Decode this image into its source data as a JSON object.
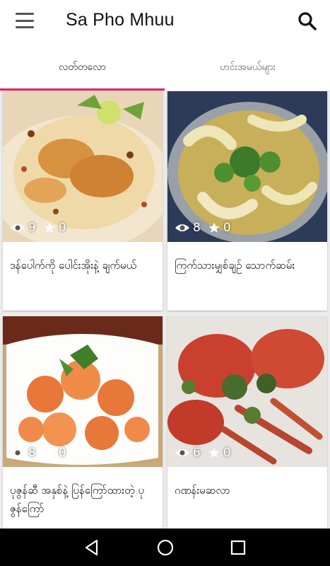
{
  "app": {
    "title": "Sa Pho Mhuu"
  },
  "tabs": [
    {
      "label": "လတ်တလော",
      "active": true
    },
    {
      "label": "ဟင်းအမယ်များ",
      "active": false
    }
  ],
  "colors": {
    "tab_indicator": "#e91e63",
    "appbar": "#ffffff",
    "background": "#ececec"
  },
  "cards": [
    {
      "title": "ဒန်ပေါက်ကို ပေါင်းအိုးနဲ့ ချက်မယ်",
      "views": "9",
      "stars": "0",
      "image": "chicken-biryani-photo"
    },
    {
      "title": "ကြက်သားမျှစ်ချဉ် သောက်ဆမ်း",
      "views": "8",
      "stars": "0",
      "image": "chicken-feet-curry-photo"
    },
    {
      "title": "ပုဇွန်ဆီ အနှစ်နဲ့ ပြန်ကြော်ထားတဲ့ ပုဇွန်ကြော်",
      "views": "8",
      "stars": "0",
      "image": "fried-prawns-photo"
    },
    {
      "title": "ဂဏန်းမဆလာ",
      "views": "6",
      "stars": "0",
      "image": "crab-masala-photo"
    }
  ],
  "icons": {
    "menu": "menu-icon",
    "search": "search-icon",
    "eye": "eye-icon",
    "star": "star-icon",
    "back": "back-icon",
    "home": "home-icon",
    "recents": "recents-icon"
  }
}
